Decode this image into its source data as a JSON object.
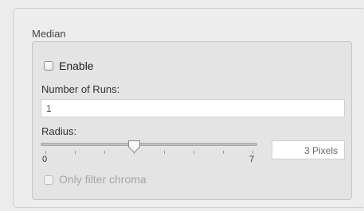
{
  "median": {
    "title": "Median",
    "enable": {
      "label": "Enable",
      "checked": false
    },
    "runs": {
      "label": "Number of Runs:",
      "value": "1"
    },
    "radius": {
      "label": "Radius:",
      "min_label": "0",
      "max_label": "7",
      "min": 0,
      "max": 7,
      "value": 3,
      "value_text": "3 Pixels"
    },
    "chroma": {
      "label": "Only filter chroma",
      "checked": false,
      "enabled": false
    }
  },
  "colors": {
    "panel": "#ededed",
    "group_fill": "#e4e4e4",
    "disabled_text": "#a5a5a5"
  }
}
